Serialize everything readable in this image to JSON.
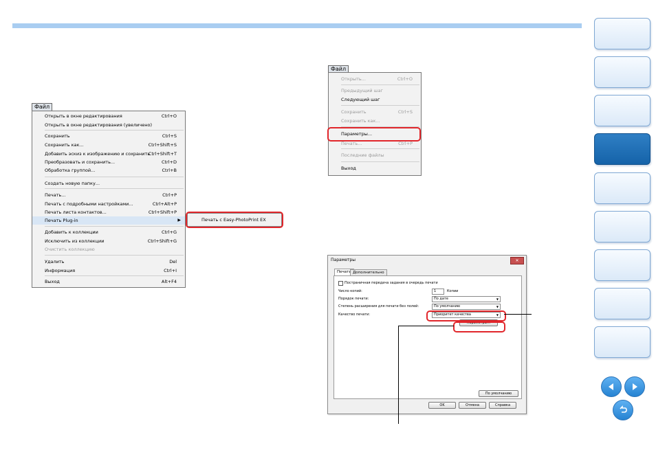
{
  "colors": {
    "accent_bar": "#a9cdf1",
    "highlight_red": "#e1252a",
    "nav_active": "#1d6fb6"
  },
  "left_menu": {
    "title": "Файл",
    "items": [
      {
        "label": "Открыть в окне редактирования",
        "shortcut": "Ctrl+O"
      },
      {
        "label": "Открыть в окне редактирования (увеличено)",
        "shortcut": ""
      },
      {
        "label": "Сохранить",
        "shortcut": "Ctrl+S"
      },
      {
        "label": "Сохранить как...",
        "shortcut": "Ctrl+Shift+S"
      },
      {
        "label": "Добавить эскиз к изображению и сохранить",
        "shortcut": "Ctrl+Shift+T"
      },
      {
        "label": "Преобразовать и сохранить...",
        "shortcut": "Ctrl+D"
      },
      {
        "label": "Обработка группой...",
        "shortcut": "Ctrl+B"
      },
      {
        "label": "Создать новую папку...",
        "shortcut": ""
      },
      {
        "label": "Печать...",
        "shortcut": "Ctrl+P"
      },
      {
        "label": "Печать с подробными настройками...",
        "shortcut": "Ctrl+Alt+P"
      },
      {
        "label": "Печать листа контактов...",
        "shortcut": "Ctrl+Shift+P"
      },
      {
        "label": "Печать Plug-in",
        "shortcut": ""
      },
      {
        "label": "Добавить к коллекции",
        "shortcut": "Ctrl+G"
      },
      {
        "label": "Исключить из коллекции",
        "shortcut": "Ctrl+Shift+G"
      },
      {
        "label": "Очистить коллекцию",
        "shortcut": ""
      },
      {
        "label": "Удалить",
        "shortcut": "Del"
      },
      {
        "label": "Информация",
        "shortcut": "Ctrl+I"
      },
      {
        "label": "Выход",
        "shortcut": "Alt+F4"
      }
    ],
    "submenu_item": "Печать с Easy-PhotoPrint EX"
  },
  "right_menu": {
    "title": "Файл",
    "items": [
      {
        "label": "Открыть...",
        "shortcut": "Ctrl+O"
      },
      {
        "label": "Предыдущий шаг",
        "shortcut": ""
      },
      {
        "label": "Следующий шаг",
        "shortcut": ""
      },
      {
        "label": "Сохранить",
        "shortcut": "Ctrl+S"
      },
      {
        "label": "Сохранить как...",
        "shortcut": ""
      },
      {
        "label": "Параметры...",
        "shortcut": ""
      },
      {
        "label": "Печать...",
        "shortcut": "Ctrl+P"
      },
      {
        "label": "Последние файлы",
        "shortcut": ""
      },
      {
        "label": "Выход",
        "shortcut": ""
      }
    ]
  },
  "dialog": {
    "title": "Параметры",
    "close": "✕",
    "tabs": [
      "Печать",
      "Дополнительно"
    ],
    "checkbox_label": "Постраничная передача задания в очередь печати",
    "copies_label": "Число копий:",
    "copies_value": "1",
    "copies_unit": "Копии",
    "order_label": "Порядок печати:",
    "order_value": "По дате",
    "extension_label": "Степень расширения для печати без полей:",
    "extension_value": "По умолчанию",
    "quality_label": "Качество печати:",
    "quality_value": "Приоритет качества",
    "params_button": "Параметры...",
    "defaults_button": "По умолчанию",
    "ok_button": "OK",
    "cancel_button": "Отмена",
    "help_button": "Справка"
  }
}
